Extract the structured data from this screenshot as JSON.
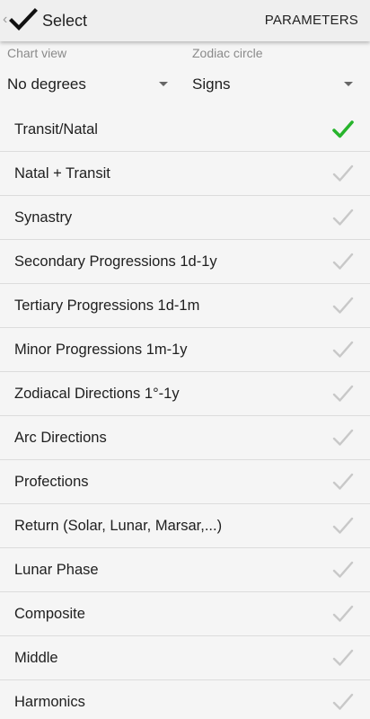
{
  "action_bar": {
    "title": "Select",
    "parameters_label": "PARAMETERS",
    "back_icon": "chevron-left-icon",
    "confirm_icon": "check-icon"
  },
  "spinners": {
    "chart_view": {
      "label": "Chart view",
      "value": "No degrees"
    },
    "zodiac_circle": {
      "label": "Zodiac circle",
      "value": "Signs"
    }
  },
  "colors": {
    "selected_check": "#27b42c",
    "unselected_check": "#c8c8c8"
  },
  "list": {
    "items": [
      {
        "label": "Transit/Natal",
        "selected": true
      },
      {
        "label": "Natal + Transit",
        "selected": false
      },
      {
        "label": "Synastry",
        "selected": false
      },
      {
        "label": "Secondary Progressions 1d-1y",
        "selected": false
      },
      {
        "label": "Tertiary Progressions 1d-1m",
        "selected": false
      },
      {
        "label": "Minor Progressions 1m-1y",
        "selected": false
      },
      {
        "label": "Zodiacal Directions 1°-1y",
        "selected": false
      },
      {
        "label": "Arc Directions",
        "selected": false
      },
      {
        "label": "Profections",
        "selected": false
      },
      {
        "label": "Return (Solar, Lunar, Marsar,...)",
        "selected": false
      },
      {
        "label": "Lunar Phase",
        "selected": false
      },
      {
        "label": "Composite",
        "selected": false
      },
      {
        "label": "Middle",
        "selected": false
      },
      {
        "label": "Harmonics",
        "selected": false
      }
    ]
  }
}
